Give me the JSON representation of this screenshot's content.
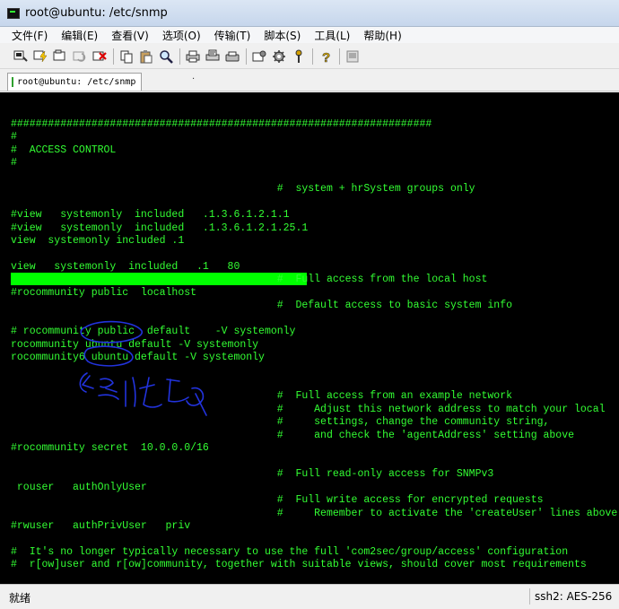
{
  "window": {
    "title": "root@ubuntu: /etc/snmp",
    "icon": "terminal-icon"
  },
  "menu": [
    {
      "label": "文件(F)"
    },
    {
      "label": "编辑(E)"
    },
    {
      "label": "查看(V)"
    },
    {
      "label": "选项(O)"
    },
    {
      "label": "传输(T)"
    },
    {
      "label": "脚本(S)"
    },
    {
      "label": "工具(L)"
    },
    {
      "label": "帮助(H)"
    }
  ],
  "toolbar": {
    "icons": [
      "connect-icon",
      "quick-connect-icon",
      "connect-tab-icon",
      "reconnect-icon",
      "disconnect-icon",
      "copy-icon",
      "paste-icon",
      "find-icon",
      "print-icon",
      "print-selection-icon",
      "printer-icon",
      "session-options-icon",
      "global-options-icon",
      "keymap-icon",
      "help-icon",
      "sftp-icon"
    ]
  },
  "tab": {
    "label": "root@ubuntu: /etc/snmp",
    "dot": "·"
  },
  "terminal": {
    "lines": [
      "####################################################################",
      "#",
      "#  ACCESS CONTROL",
      "#",
      "",
      "                                           #  system + hrSystem groups only",
      "",
      "#view   systemonly  included   .1.3.6.1.2.1.1",
      "#view   systemonly  included   .1.3.6.1.2.1.25.1",
      "view  systemonly included .1",
      "",
      "view   systemonly  included   .1   80",
      "                                           #  Full access from the local host",
      "#rocommunity public  localhost",
      "                                           #  Default access to basic system info",
      "",
      "# rocommunity public  default    -V systemonly",
      "rocommunity ubuntu default -V systemonly",
      "rocommunity6 ubuntu default -V systemonly",
      "",
      "",
      "                                           #  Full access from an example network",
      "                                           #     Adjust this network address to match your local",
      "                                           #     settings, change the community string,",
      "                                           #     and check the 'agentAddress' setting above",
      "#rocommunity secret  10.0.0.0/16",
      "",
      "                                           #  Full read-only access for SNMPv3",
      " rouser   authOnlyUser",
      "                                           #  Full write access for encrypted requests",
      "                                           #     Remember to activate the 'createUser' lines above",
      "#rwuser   authPrivUser   priv",
      "",
      "#  It's no longer typically necessary to use the full 'com2sec/group/access' configuration",
      "#  r[ow]user and r[ow]community, together with suitable views, should cover most requirements"
    ]
  },
  "status": {
    "left": "就绪",
    "right": "ssh2: AES-256"
  },
  "colors": {
    "terminal_bg": "#000000",
    "terminal_fg": "#33ff33",
    "highlight": "#00ff00",
    "annotation": "#2233dd"
  }
}
